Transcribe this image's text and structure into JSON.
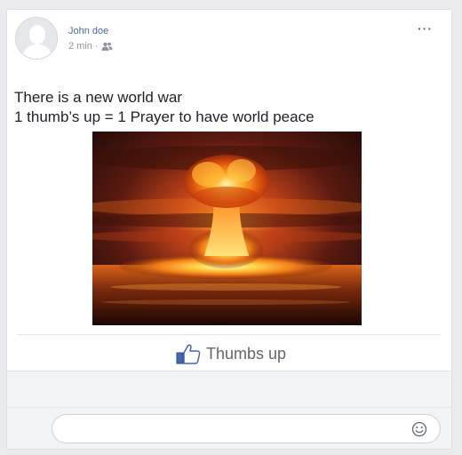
{
  "post": {
    "author": "John doe",
    "time": "2 min",
    "separator": "·",
    "text_line1": "There is a new world war",
    "text_line2": "1 thumb’s up = 1 Prayer to have world peace",
    "audience_icon": "friends-icon",
    "more_icon": "more-options-icon",
    "more_glyph": "···",
    "image_description_icon": "explosion-image"
  },
  "actions": {
    "like_label": "Thumbs up",
    "like_icon": "thumbs-up-icon"
  },
  "comment": {
    "placeholder": "",
    "emoji_icon": "smiley-icon"
  },
  "colors": {
    "author_link": "#4b67a1",
    "meta_text": "#90949c",
    "like_blue": "#4267b2",
    "page_bg": "#e9ebee"
  }
}
